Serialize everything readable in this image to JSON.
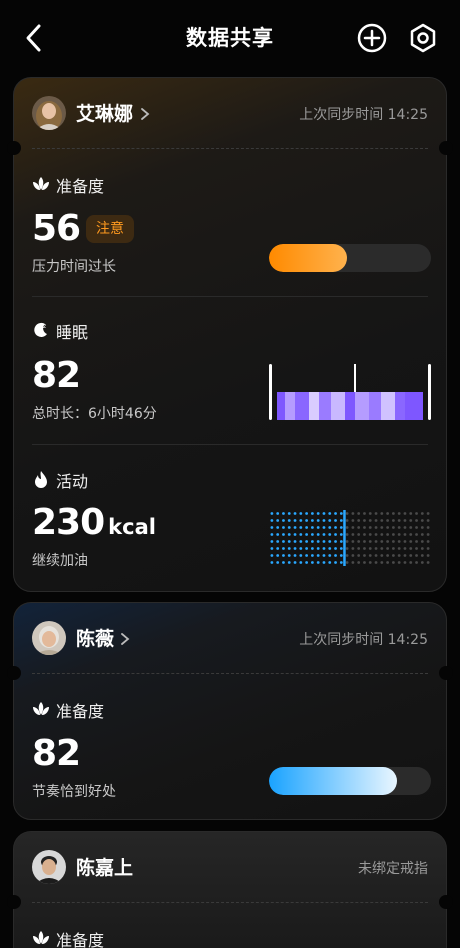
{
  "header": {
    "title": "数据共享",
    "back_icon": "chevron-left-icon",
    "add_icon": "plus-circle-icon",
    "settings_icon": "gear-icon"
  },
  "cards": [
    {
      "user": "艾琳娜",
      "sync": "上次同步时间 14:25",
      "readiness": {
        "label": "准备度",
        "value": "56",
        "badge": "注意",
        "note": "压力时间过长",
        "level": 0.48,
        "color": "#ff9a1f"
      },
      "sleep": {
        "label": "睡眠",
        "value": "82",
        "note": "总时长：6小时46分"
      },
      "activity": {
        "label": "活动",
        "value": "230",
        "unit": "kcal",
        "note": "继续加油",
        "progress": 0.45,
        "color": "#2aa8ff"
      }
    },
    {
      "user": "陈薇",
      "sync": "上次同步时间 14:25",
      "readiness": {
        "label": "准备度",
        "value": "82",
        "note": "节奏恰到好处",
        "level": 0.79
      }
    },
    {
      "user": "陈嘉上",
      "sync": "未绑定戒指",
      "readiness": {
        "label": "准备度"
      }
    }
  ]
}
